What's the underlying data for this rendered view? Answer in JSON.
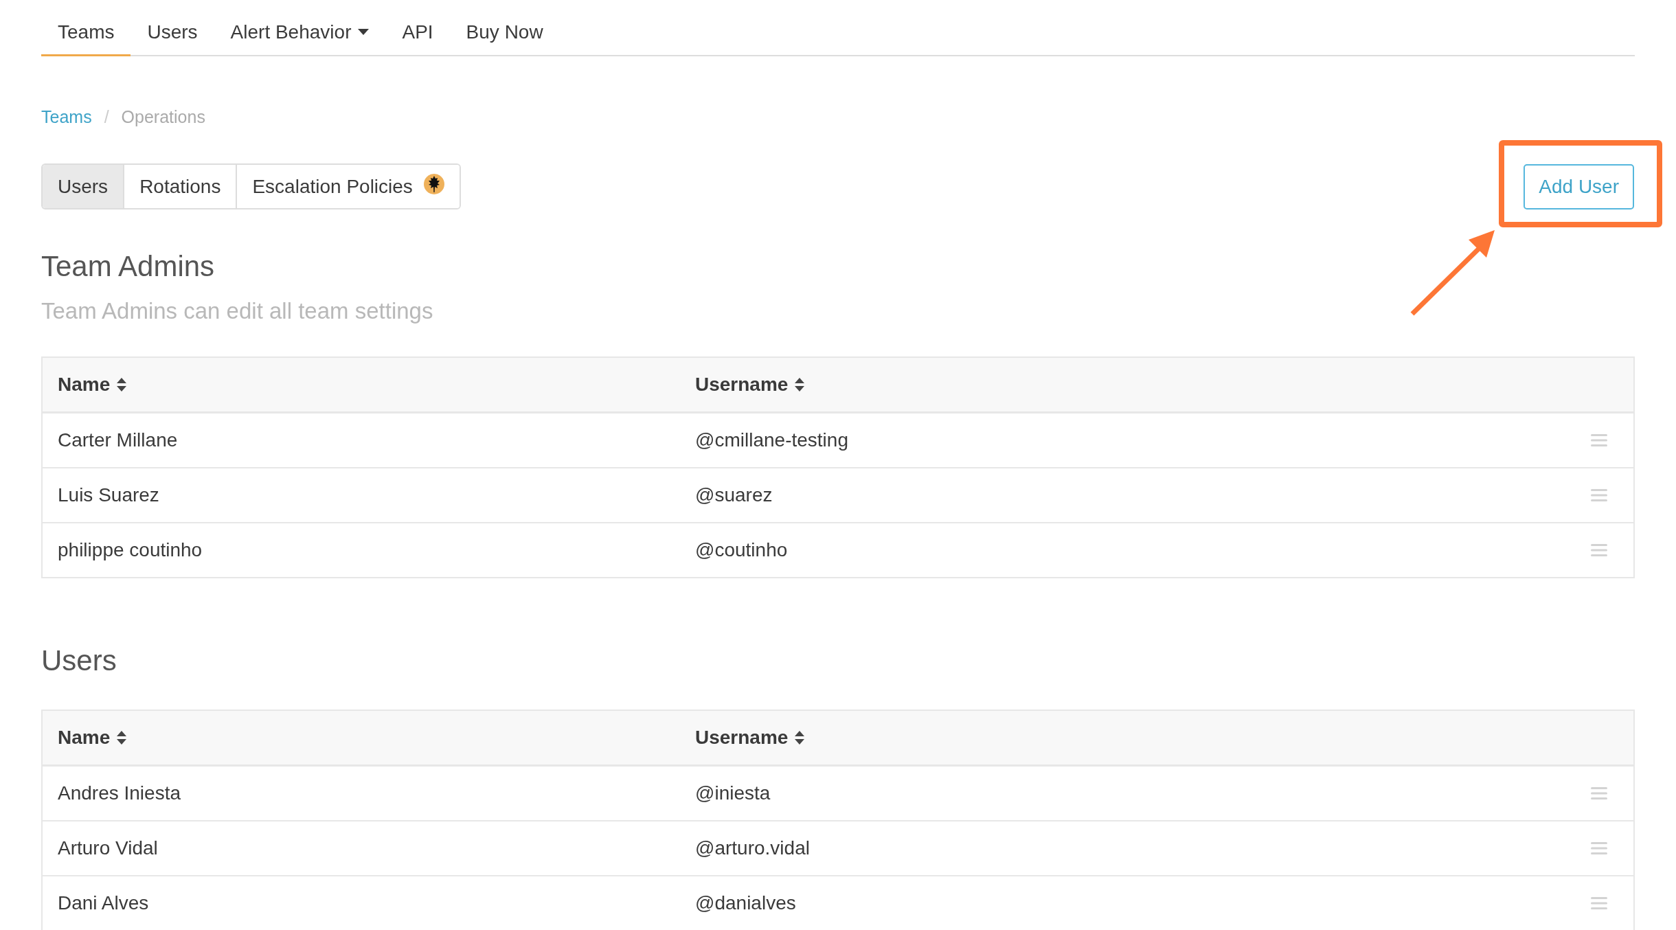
{
  "nav": {
    "items": [
      {
        "label": "Teams",
        "selected": true,
        "has_menu": false
      },
      {
        "label": "Users",
        "selected": false,
        "has_menu": false
      },
      {
        "label": "Alert Behavior",
        "selected": false,
        "has_menu": true
      },
      {
        "label": "API",
        "selected": false,
        "has_menu": false
      },
      {
        "label": "Buy Now",
        "selected": false,
        "has_menu": false
      }
    ]
  },
  "breadcrumb": [
    {
      "label": "Teams",
      "kind": "link"
    },
    {
      "label": "/",
      "kind": "separator"
    },
    {
      "label": "Operations",
      "kind": "current"
    }
  ],
  "tabs": [
    {
      "label": "Users",
      "selected": true,
      "badge": false
    },
    {
      "label": "Rotations",
      "selected": false,
      "badge": false
    },
    {
      "label": "Escalation Policies",
      "selected": false,
      "badge": true
    }
  ],
  "add_button": "Add User",
  "sections": [
    {
      "title": "Team Admins",
      "subtitle": "Team Admins can edit all team settings",
      "columns": [
        "Name",
        "Username"
      ],
      "rows": [
        {
          "name": "Carter Millane",
          "username": "@cmillane-testing"
        },
        {
          "name": "Luis Suarez",
          "username": "@suarez"
        },
        {
          "name": "philippe coutinho",
          "username": "@coutinho"
        }
      ]
    },
    {
      "title": "Users",
      "columns": [
        "Name",
        "Username"
      ],
      "rows": [
        {
          "name": "Andres Iniesta",
          "username": "@iniesta"
        },
        {
          "name": "Arturo Vidal",
          "username": "@arturo.vidal"
        },
        {
          "name": "Dani Alves",
          "username": "@danialves"
        }
      ]
    }
  ]
}
